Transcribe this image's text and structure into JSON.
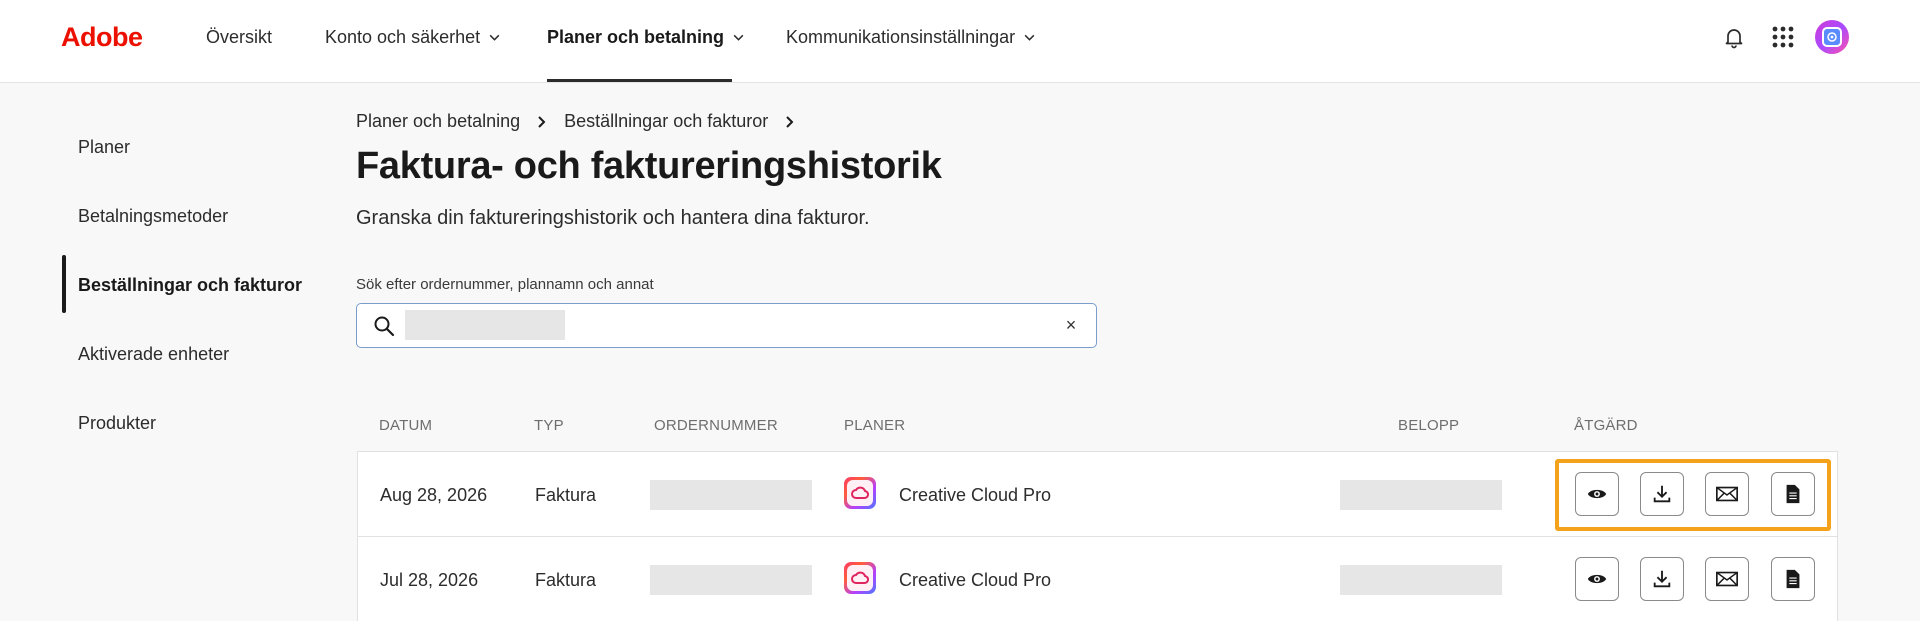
{
  "brand": {
    "logo_text": "Adobe",
    "logo_color": "#eb1000"
  },
  "topnav": {
    "items": [
      {
        "label": "Översikt",
        "has_dropdown": false,
        "active": false
      },
      {
        "label": "Konto och säkerhet",
        "has_dropdown": true,
        "active": false
      },
      {
        "label": "Planer och betalning",
        "has_dropdown": true,
        "active": true
      },
      {
        "label": "Kommunikationsinställningar",
        "has_dropdown": true,
        "active": false
      }
    ],
    "icons": [
      "bell-icon",
      "apps-grid-icon",
      "avatar"
    ]
  },
  "sidebar": {
    "items": [
      {
        "label": "Planer",
        "active": false
      },
      {
        "label": "Betalningsmetoder",
        "active": false
      },
      {
        "label": "Beställningar och fakturor",
        "active": true
      },
      {
        "label": "Aktiverade enheter",
        "active": false
      },
      {
        "label": "Produkter",
        "active": false
      }
    ]
  },
  "breadcrumb": [
    "Planer och betalning",
    "Beställningar och fakturor"
  ],
  "page": {
    "title": "Faktura- och faktureringshistorik",
    "subtitle": "Granska din faktureringshistorik och hantera dina fakturor."
  },
  "search": {
    "label": "Sök efter ordernummer, plannamn och annat",
    "value": "",
    "clear_label": "×"
  },
  "table": {
    "columns": [
      "DATUM",
      "TYP",
      "ORDERNUMMER",
      "PLANER",
      "BELOPP",
      "ÅTGÄRD"
    ],
    "rows": [
      {
        "date": "Aug 28, 2026",
        "type": "Faktura",
        "plan": "Creative Cloud Pro",
        "highlighted": true
      },
      {
        "date": "Jul 28, 2026",
        "type": "Faktura",
        "plan": "Creative Cloud Pro",
        "highlighted": false
      }
    ],
    "actions": [
      "view-icon",
      "download-icon",
      "email-icon",
      "document-icon"
    ]
  },
  "colors": {
    "accent": "#eb1000",
    "highlight_border": "#f4a11c",
    "search_border": "#7a9ec9"
  }
}
